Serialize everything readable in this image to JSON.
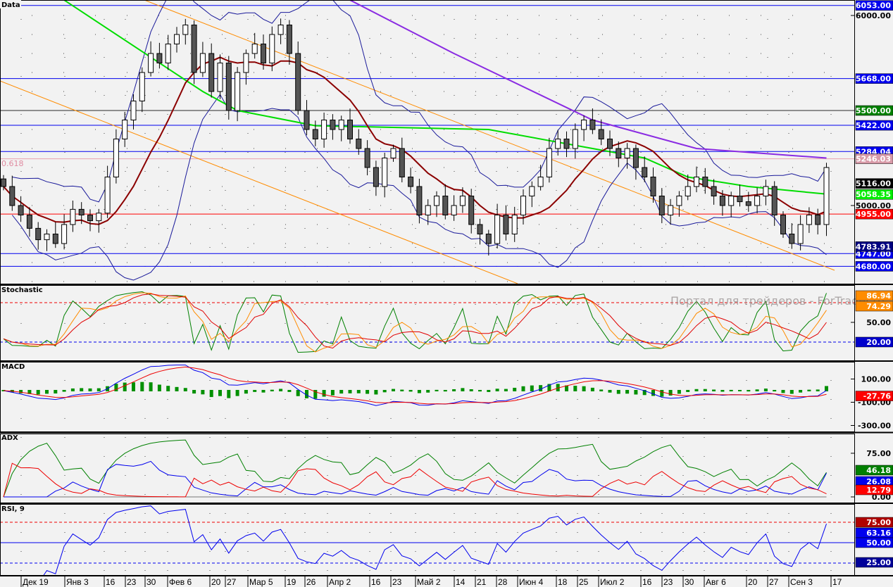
{
  "colors": {
    "up": "#ffffff",
    "down": "#555555",
    "ma_fast": "#8b0000",
    "ma_mid": "#00dd00",
    "ma_slow": "#8a2be2",
    "bands": "#1a1a9a",
    "trend": "#ff8c00",
    "blue": "#0000ee",
    "red": "#ff0000",
    "green": "#008000",
    "orange": "#ff8c00"
  },
  "panels": {
    "main": {
      "title": "Data",
      "fib_label": "0.618"
    },
    "stochastic": {
      "title": "Stochastic",
      "watermark": "Портал для трейдеров - ForTrader.ru"
    },
    "macd": {
      "title": "MACD"
    },
    "adx": {
      "title": "ADX"
    },
    "rsi": {
      "title": "RSI, 9"
    }
  },
  "chart_data": {
    "type": "candlestick",
    "title": "Data",
    "ylim": [
      4589,
      6081
    ],
    "close": [
      5100,
      5000,
      4950,
      4880,
      4820,
      4850,
      4800,
      4900,
      4980,
      4950,
      4920,
      4960,
      5150,
      5350,
      5450,
      5550,
      5700,
      5800,
      5750,
      5850,
      5900,
      5950,
      5700,
      5800,
      5600,
      5750,
      5500,
      5700,
      5800,
      5850,
      5750,
      5900,
      5950,
      5800,
      5500,
      5400,
      5350,
      5450,
      5400,
      5450,
      5350,
      5300,
      5200,
      5100,
      5250,
      5300,
      5150,
      5100,
      4950,
      5000,
      5050,
      4950,
      5000,
      5050,
      4900,
      4850,
      4800,
      4950,
      4850,
      4950,
      5050,
      5100,
      5150,
      5300,
      5350,
      5300,
      5400,
      5450,
      5400,
      5350,
      5300,
      5250,
      5300,
      5200,
      5150,
      5050,
      4950,
      5000,
      5050,
      5100,
      5150,
      5100,
      5050,
      5000,
      5050,
      5020,
      5000,
      5050,
      5100,
      4950,
      4850,
      4800,
      4900,
      4950,
      4900,
      5200
    ],
    "ma_mid": [
      [
        7,
        6081
      ],
      [
        23,
        5600
      ],
      [
        27,
        5500
      ],
      [
        36,
        5420
      ],
      [
        56,
        5400
      ],
      [
        68,
        5300
      ],
      [
        74,
        5250
      ],
      [
        79,
        5150
      ],
      [
        86,
        5100
      ],
      [
        95,
        5060
      ]
    ],
    "ma_slow": [
      [
        40,
        6081
      ],
      [
        52,
        5800
      ],
      [
        68,
        5450
      ],
      [
        80,
        5300
      ],
      [
        95,
        5250
      ]
    ],
    "levels": [
      {
        "value": 6053,
        "label": "6053.00",
        "color": "#0000ee",
        "line": "#0000ee"
      },
      {
        "value": 5668,
        "label": "5668.00",
        "color": "#0000ee",
        "line": "#0000ee"
      },
      {
        "value": 5500,
        "label": "5500.00",
        "color": "#008000",
        "line": "#2a2a2a"
      },
      {
        "value": 5422,
        "label": "5422.00",
        "color": "#0000ee",
        "line": "#0000ee"
      },
      {
        "value": 5284.04,
        "label": "5284.04",
        "color": "#0000ee",
        "line": "#0000ee"
      },
      {
        "value": 5246.03,
        "label": "5246.03",
        "color": "#d89aa8",
        "line": "#e8a0b0",
        "text": "#000000"
      },
      {
        "value": 4955,
        "label": "4955.00",
        "color": "#ff0000",
        "line": "#ff0000"
      },
      {
        "value": 4747,
        "label": "4747.00",
        "color": "#0000ee",
        "line": "#0000ee"
      },
      {
        "value": 4680,
        "label": "4680.00",
        "color": "#0000ee",
        "line": "#0000ee"
      }
    ],
    "price_badges": [
      {
        "value": 5116,
        "label": "5116.00",
        "color": "#000000"
      },
      {
        "value": 5058.35,
        "label": "5058.35",
        "color": "#00ee00"
      },
      {
        "value": 4783.91,
        "label": "4783.91",
        "color": "#000080"
      }
    ],
    "yticks": [
      {
        "value": 6000,
        "label": "6000.00"
      },
      {
        "value": 5000,
        "label": "5000.00"
      }
    ],
    "stochastic": {
      "ticks": [
        {
          "value": 50,
          "label": "50.00"
        }
      ],
      "levels": [
        80,
        20
      ],
      "badges": [
        {
          "value": 86.94,
          "label": "86.94",
          "color": "#ff8c00"
        },
        {
          "value": 74.29,
          "label": "74.29",
          "color": "#ff8c00"
        },
        {
          "value": 20,
          "label": "20.00",
          "color": "#0000cc"
        }
      ]
    },
    "macd": {
      "ticks": [
        {
          "value": 100,
          "label": "100.00"
        },
        {
          "value": -100,
          "label": "-100.00"
        },
        {
          "value": -300,
          "label": "-300.00"
        }
      ],
      "badges": [
        {
          "value": -27.76,
          "label": "-27.76",
          "color": "#ff0000"
        }
      ]
    },
    "adx": {
      "ticks": [
        {
          "value": 75,
          "label": "75.00"
        },
        {
          "value": 0,
          "label": "0.00"
        }
      ],
      "badges": [
        {
          "value": 46.18,
          "label": "46.18",
          "color": "#008000"
        },
        {
          "value": 26.08,
          "label": "26.08",
          "color": "#0000ee"
        },
        {
          "value": 12.79,
          "label": "12.79",
          "color": "#ff0000"
        }
      ]
    },
    "rsi": {
      "levels": [
        75,
        50,
        25
      ],
      "badges": [
        {
          "value": 75,
          "label": "75.00",
          "color": "#b00000"
        },
        {
          "value": 63.16,
          "label": "63.16",
          "color": "#0000ee"
        },
        {
          "value": 50,
          "label": "50.00",
          "color": "#0000ee"
        },
        {
          "value": 25,
          "label": "25.00",
          "color": "#000099"
        }
      ]
    },
    "xticks": [
      "Дек 19",
      "Янв 3",
      "16",
      "23",
      "30",
      "Фев 6",
      "20",
      "27",
      "Мар 5",
      "19",
      "26",
      "Апр 2",
      "16",
      "23",
      "Май 2",
      "14",
      "21",
      "28",
      "Июн 4",
      "18",
      "25",
      "Июл 2",
      "16",
      "23",
      "30",
      "Авг 6",
      "20",
      "27",
      "Сен 3",
      "17"
    ]
  }
}
